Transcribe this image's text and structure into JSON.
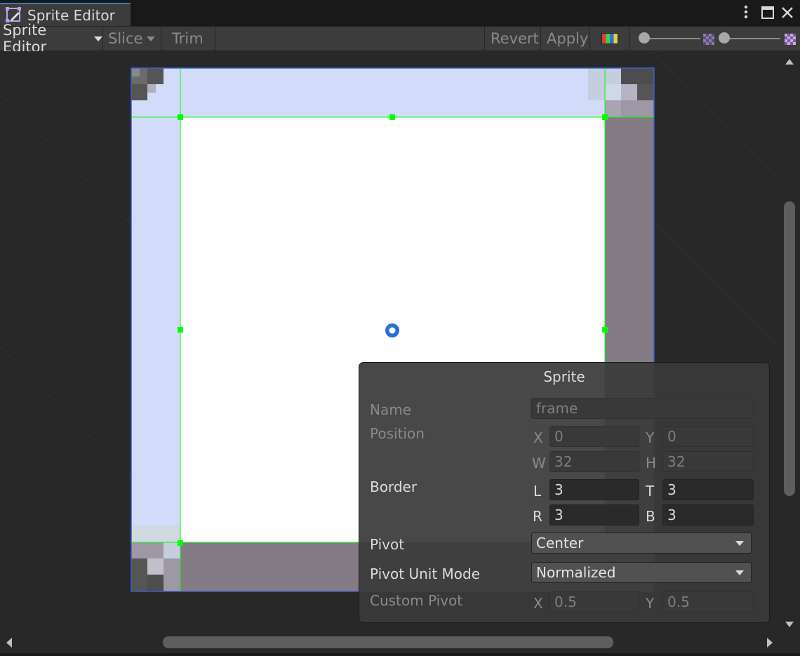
{
  "window": {
    "tab_title": "Sprite Editor",
    "controls": {
      "menu_icon": "more-vert-icon",
      "maximize_icon": "maximize-icon",
      "close_icon": "close-icon"
    }
  },
  "toolbar": {
    "mode_label": "Sprite Editor",
    "slice_label": "Slice",
    "trim_label": "Trim",
    "revert_label": "Revert",
    "apply_label": "Apply",
    "slider1_value": 0.0,
    "slider2_value": 0.0
  },
  "colors": {
    "accent": "#3a79bb",
    "border_handle": "#00ff00",
    "sprite_tint": "#d2dcfa",
    "selection_outline": "#3a5fc8"
  },
  "sprite_panel": {
    "title": "Sprite",
    "name_label": "Name",
    "name_value": "frame",
    "position_label": "Position",
    "x_label": "X",
    "x_value": "0",
    "y_label": "Y",
    "y_value": "0",
    "w_label": "W",
    "w_value": "32",
    "h_label": "H",
    "h_value": "32",
    "border_label": "Border",
    "l_label": "L",
    "l_value": "3",
    "t_label": "T",
    "t_value": "3",
    "r_label": "R",
    "r_value": "3",
    "b_label": "B",
    "b_value": "3",
    "pivot_label": "Pivot",
    "pivot_value": "Center",
    "pivot_unit_label": "Pivot Unit Mode",
    "pivot_unit_value": "Normalized",
    "custom_pivot_label": "Custom Pivot",
    "cx_label": "X",
    "cx_value": "0.5",
    "cy_label": "Y",
    "cy_value": "0.5"
  }
}
